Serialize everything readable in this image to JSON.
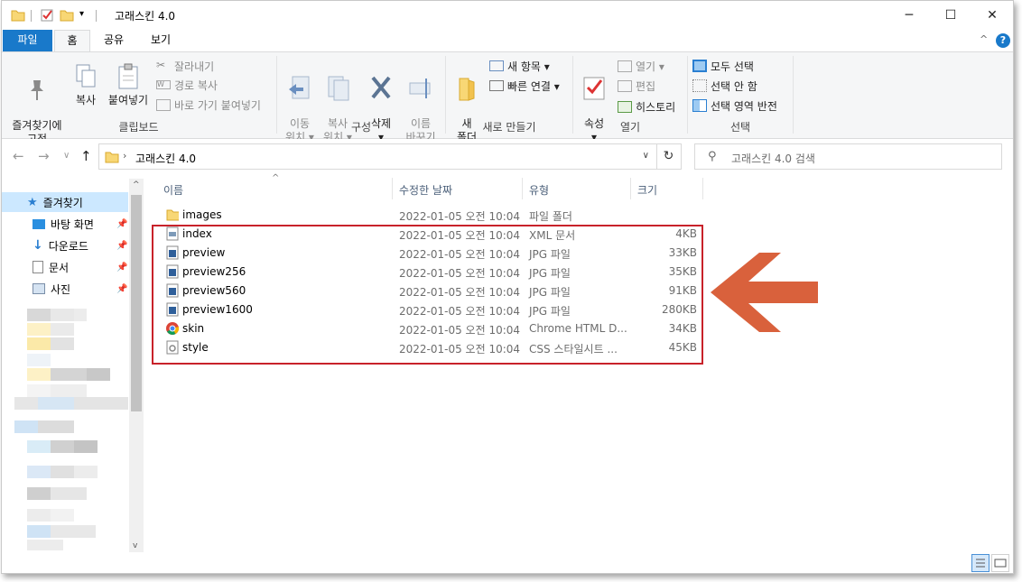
{
  "window": {
    "title": "고래스킨 4.0"
  },
  "ribbon_tabs": [
    "파일",
    "홈",
    "공유",
    "보기"
  ],
  "ribbon": {
    "clipboard": {
      "label": "클립보드",
      "pin": "즐겨찾기에\n고정",
      "copy": "복사",
      "paste": "붙여넣기",
      "cut": "잘라내기",
      "copy_path": "경로 복사",
      "paste_shortcut": "바로 가기 붙여넣기"
    },
    "organize": {
      "label": "구성",
      "move_to": "이동\n위치 ▾",
      "copy_to": "복사\n위치 ▾",
      "delete": "삭제\n▾",
      "rename": "이름\n바꾸기"
    },
    "new": {
      "label": "새로 만들기",
      "new_folder": "새\n폴더",
      "new_item": "새 항목 ▾",
      "easy_access": "빠른 연결 ▾"
    },
    "open": {
      "label": "열기",
      "properties": "속성\n▾",
      "open": "열기 ▾",
      "edit": "편집",
      "history": "히스토리"
    },
    "select": {
      "label": "선택",
      "select_all": "모두 선택",
      "select_none": "선택 안 함",
      "invert": "선택 영역 반전"
    }
  },
  "address": {
    "path": "고래스킨 4.0",
    "search_placeholder": "고래스킨 4.0 검색"
  },
  "nav_pane": {
    "items": [
      {
        "label": "즐겨찾기",
        "icon": "star-icon"
      },
      {
        "label": "바탕 화면",
        "icon": "desktop-icon"
      },
      {
        "label": "다운로드",
        "icon": "download-icon"
      },
      {
        "label": "문서",
        "icon": "document-icon"
      },
      {
        "label": "사진",
        "icon": "pictures-icon"
      }
    ]
  },
  "columns": [
    "이름",
    "수정한 날짜",
    "유형",
    "크기"
  ],
  "files": [
    {
      "name": "images",
      "date": "2022-01-05 오전 10:04",
      "type": "파일 폴더",
      "size": "",
      "icon": "folder-icon"
    },
    {
      "name": "index",
      "date": "2022-01-05 오전 10:04",
      "type": "XML 문서",
      "size": "4KB",
      "icon": "xml-file-icon"
    },
    {
      "name": "preview",
      "date": "2022-01-05 오전 10:04",
      "type": "JPG 파일",
      "size": "33KB",
      "icon": "jpg-file-icon"
    },
    {
      "name": "preview256",
      "date": "2022-01-05 오전 10:04",
      "type": "JPG 파일",
      "size": "35KB",
      "icon": "jpg-file-icon"
    },
    {
      "name": "preview560",
      "date": "2022-01-05 오전 10:04",
      "type": "JPG 파일",
      "size": "91KB",
      "icon": "jpg-file-icon"
    },
    {
      "name": "preview1600",
      "date": "2022-01-05 오전 10:04",
      "type": "JPG 파일",
      "size": "280KB",
      "icon": "jpg-file-icon"
    },
    {
      "name": "skin",
      "date": "2022-01-05 오전 10:04",
      "type": "Chrome HTML D...",
      "size": "34KB",
      "icon": "chrome-html-icon"
    },
    {
      "name": "style",
      "date": "2022-01-05 오전 10:04",
      "type": "CSS 스타일시트 ...",
      "size": "45KB",
      "icon": "css-file-icon"
    }
  ],
  "colors": {
    "accent": "#1979ca",
    "highlight_box": "#c8222a",
    "arrow": "#d9613c",
    "selected": "#cce8ff"
  }
}
